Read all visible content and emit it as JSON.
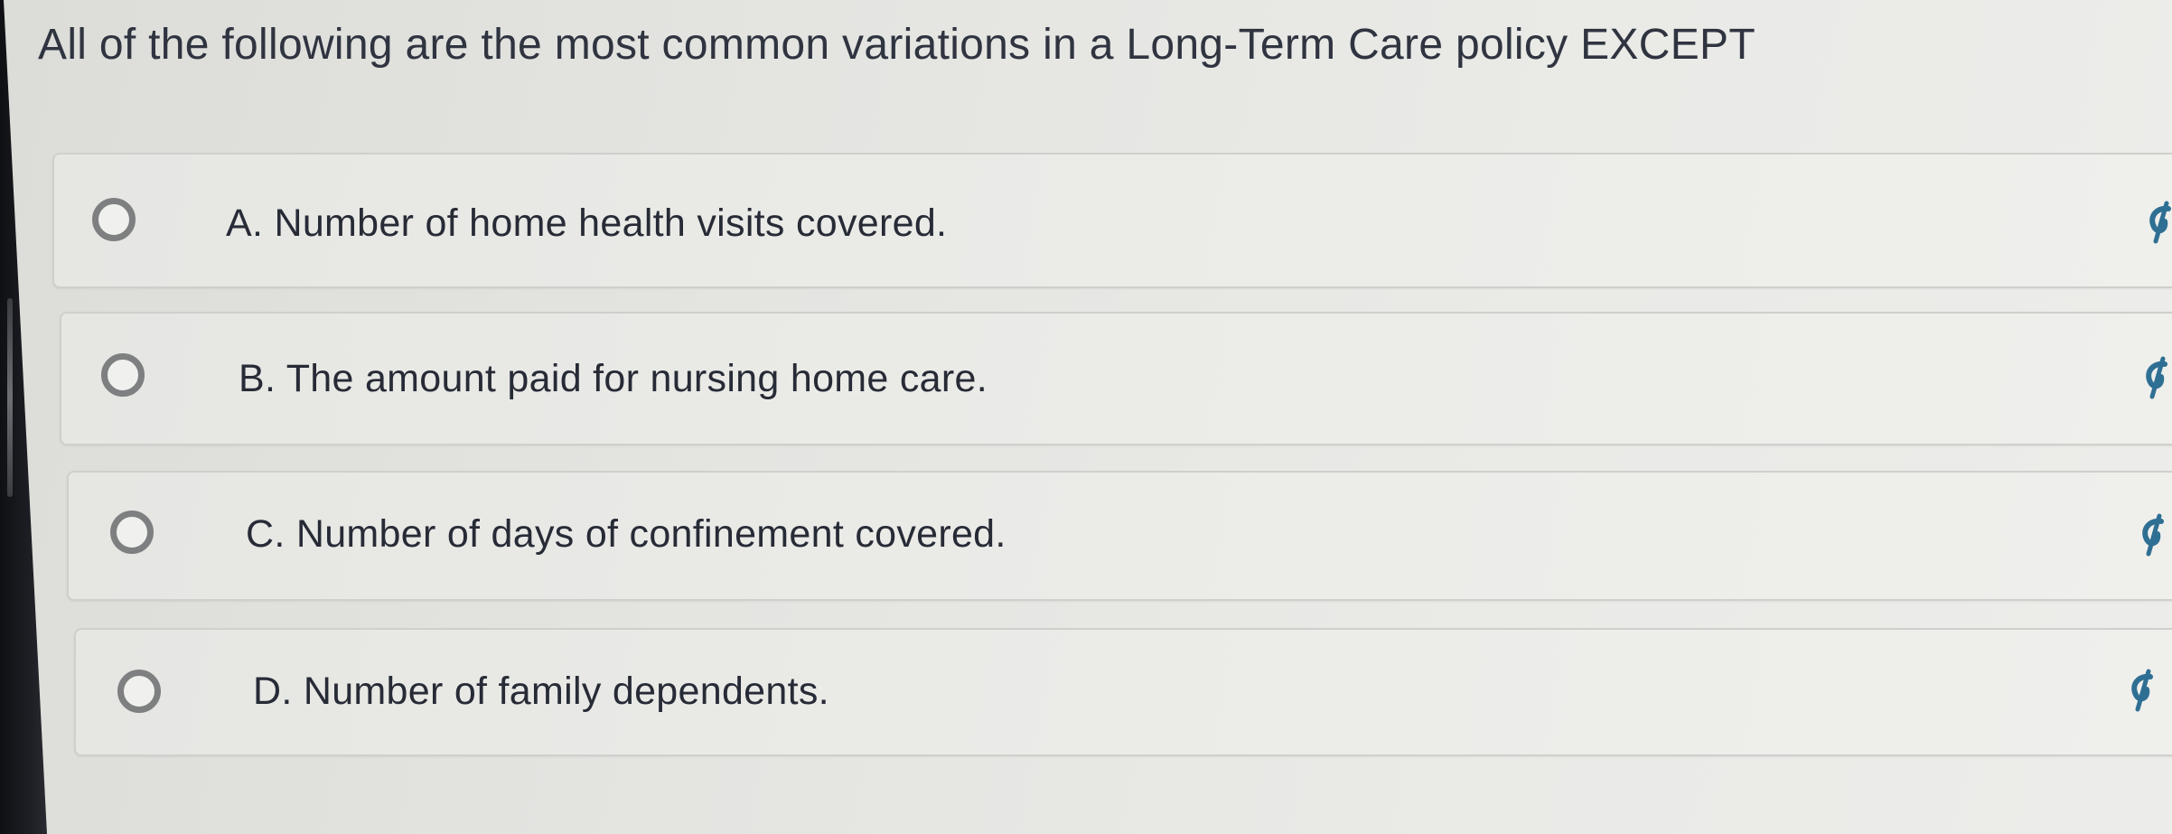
{
  "question": {
    "text": "All of the following are the most common variations in a Long-Term Care policy EXCEPT"
  },
  "options": [
    {
      "label": "A. Number of home health visits covered.",
      "icon": "strikethrough-eye-icon"
    },
    {
      "label": "B. The amount paid for nursing home care.",
      "icon": "strikethrough-eye-icon"
    },
    {
      "label": "C. Number of days of confinement covered.",
      "icon": "strikethrough-eye-icon"
    },
    {
      "label": "D. Number of family dependents.",
      "icon": "strikethrough-eye-icon"
    }
  ],
  "colors": {
    "radio_border": "#7d7f80",
    "icon_color": "#2f6f93",
    "text": "#272b36"
  }
}
